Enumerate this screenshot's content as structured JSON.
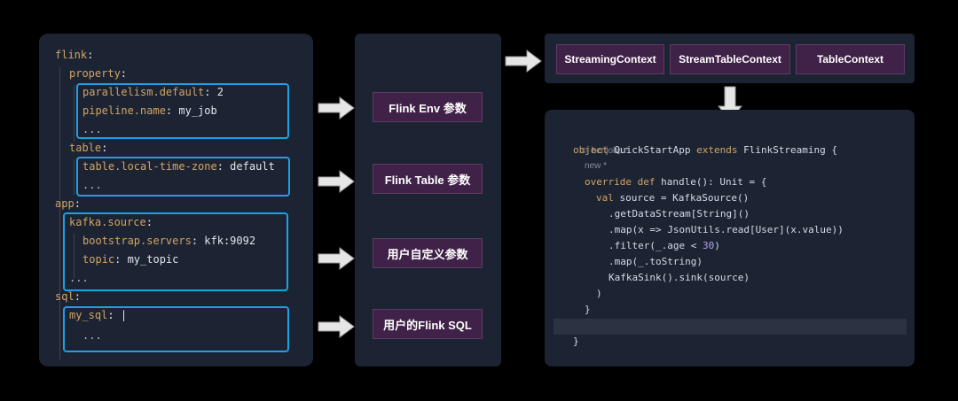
{
  "yaml": {
    "lines": [
      {
        "key": "flink",
        "sep": ":",
        "val": ""
      },
      {
        "key": "property",
        "sep": ":",
        "val": ""
      },
      {
        "key": "parallelism.default",
        "sep": ": ",
        "val": "2"
      },
      {
        "key": "pipeline.name",
        "sep": ": ",
        "val": "my_job"
      },
      {
        "key": "",
        "sep": "",
        "val": "..."
      },
      {
        "key": "table",
        "sep": ":",
        "val": ""
      },
      {
        "key": "table.local-time-zone",
        "sep": ": ",
        "val": "default"
      },
      {
        "key": "",
        "sep": "",
        "val": "..."
      },
      {
        "key": "app",
        "sep": ":",
        "val": ""
      },
      {
        "key": "kafka.source",
        "sep": ":",
        "val": ""
      },
      {
        "key": "bootstrap.servers",
        "sep": ": ",
        "val": "kfk:9092"
      },
      {
        "key": "topic",
        "sep": ": ",
        "val": "my_topic"
      },
      {
        "key": "",
        "sep": "",
        "val": "..."
      },
      {
        "key": "sql",
        "sep": ":",
        "val": ""
      },
      {
        "key": "my_sql",
        "sep": ": ",
        "val": "|"
      },
      {
        "key": "",
        "sep": "",
        "val": "..."
      }
    ]
  },
  "params": [
    {
      "label": "Flink Env 参数"
    },
    {
      "label": "Flink Table 参数"
    },
    {
      "label": "用户自定义参数"
    },
    {
      "label": "用户的Flink SQL"
    }
  ],
  "contexts": [
    {
      "label": "StreamingContext"
    },
    {
      "label": "StreamTableContext"
    },
    {
      "label": "TableContext"
    }
  ],
  "code": {
    "author_hint": "benjobs *",
    "new_hint": "new *",
    "lines": [
      [
        "object",
        " QuickStartApp ",
        "extends",
        " FlinkStreaming {"
      ],
      [
        "override def",
        " handle(): Unit = {",
        "",
        ""
      ],
      [
        "val",
        " source = KafkaSource()",
        "",
        ""
      ],
      [
        "",
        ".getDataStream[String]()",
        "",
        ""
      ],
      [
        "",
        ".map(x => JsonUtils.read[User](x.value))",
        "",
        ""
      ],
      [
        "",
        ".filter(_.age < ",
        "30",
        ")"
      ],
      [
        "",
        ".map(_.toString)",
        "",
        ""
      ],
      [
        "",
        "KafkaSink().sink(source)",
        "",
        ""
      ],
      [
        "",
        ")",
        "",
        ""
      ],
      [
        "",
        "}",
        "",
        ""
      ],
      [
        "",
        "",
        "",
        ""
      ],
      [
        "",
        "}",
        "",
        ""
      ]
    ]
  },
  "colors": {
    "panel": "#1c2333",
    "highlight": "#1ea0e6",
    "button": "#402148",
    "key": "#d3a565"
  }
}
